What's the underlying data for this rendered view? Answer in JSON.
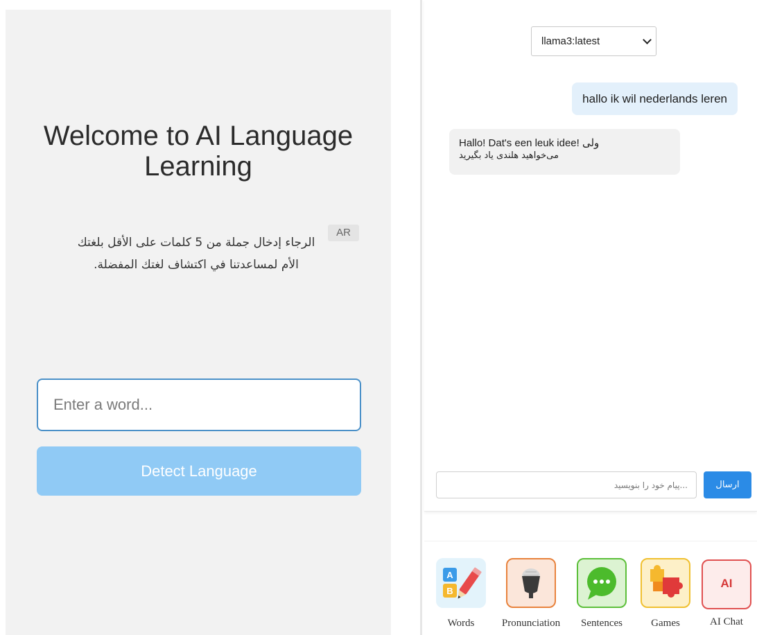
{
  "left": {
    "title": "Welcome to AI Language Learning",
    "language_badge": "AR",
    "instruction": "الرجاء إدخال جملة من 5 كلمات على الأقل بلغتك الأم لمساعدتنا في اكتشاف لغتك المفضلة.",
    "word_input_placeholder": "Enter a word...",
    "detect_button_label": "Detect Language"
  },
  "chat": {
    "model_selected": "llama3:latest",
    "messages": [
      {
        "role": "user",
        "text": "hallo ik wil nederlands leren"
      },
      {
        "role": "ai",
        "line1": "Hallo! Dat's een leuk idee! ولی",
        "line2": "می‌خواهید هلندی یاد بگیرید"
      }
    ],
    "input_placeholder": "...پیام خود را بنویسید",
    "send_label": "ارسال"
  },
  "nav": {
    "items": [
      {
        "label": "Words",
        "icon": "abc-blocks-pencil-icon"
      },
      {
        "label": "Pronunciation",
        "icon": "microphone-icon"
      },
      {
        "label": "Sentences",
        "icon": "speech-bubble-icon"
      },
      {
        "label": "Games",
        "icon": "puzzle-icon"
      },
      {
        "label": "AI Chat",
        "icon": "ai-badge-icon",
        "icon_text": "AI"
      }
    ]
  },
  "colors": {
    "accent_blue": "#2b8be6",
    "detect_button": "#90caf5",
    "user_bubble": "#e3f0fb",
    "ai_bubble": "#f1f1f1",
    "left_bg": "#f2f2f2"
  }
}
